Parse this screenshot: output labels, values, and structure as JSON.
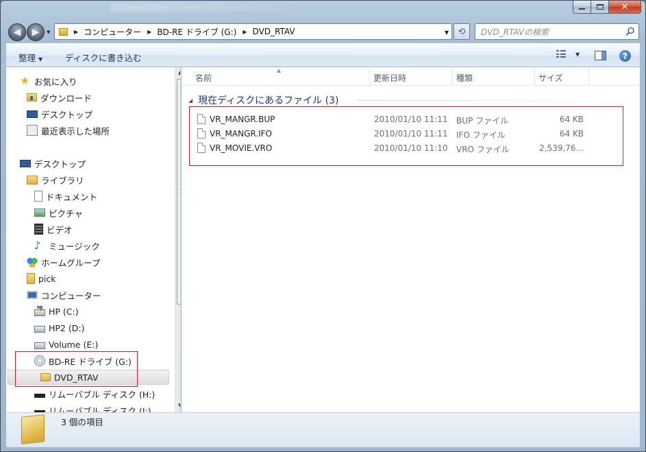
{
  "window": {
    "controls": {
      "minimize": "—",
      "maximize": "□",
      "close": "✕"
    }
  },
  "address": {
    "crumbs": [
      "コンピューター",
      "BD-RE ドライブ (G:)",
      "DVD_RTAV"
    ],
    "search_placeholder": "DVD_RTAVの検索"
  },
  "toolbar": {
    "organize_label": "整理",
    "burn_label": "ディスクに書き込む"
  },
  "nav": {
    "favorites": {
      "label": "お気に入り",
      "items": [
        "ダウンロード",
        "デスクトップ",
        "最近表示した場所"
      ]
    },
    "desktop_label": "デスクトップ",
    "libraries": {
      "label": "ライブラリ",
      "items": [
        "ドキュメント",
        "ピクチャ",
        "ビデオ",
        "ミュージック"
      ]
    },
    "homegroup_label": "ホームグループ",
    "user_label": "pick",
    "computer": {
      "label": "コンピューター",
      "drives": [
        "HP (C:)",
        "HP2 (D:)",
        "Volume (E:)",
        "BD-RE ドライブ (G:)"
      ],
      "selected_folder": "DVD_RTAV",
      "more_drives": [
        "リムーバブル ディスク (H:)",
        "リムーバブル ディスク (I:)"
      ]
    }
  },
  "columns": {
    "name": "名前",
    "date": "更新日時",
    "type": "種類",
    "size": "サイズ"
  },
  "group": {
    "title": "現在ディスクにあるファイル (3)"
  },
  "files": [
    {
      "name": "VR_MANGR.BUP",
      "date": "2010/01/10 11:11",
      "type": "BUP ファイル",
      "size": "64 KB"
    },
    {
      "name": "VR_MANGR.IFO",
      "date": "2010/01/10 11:11",
      "type": "IFO ファイル",
      "size": "64 KB"
    },
    {
      "name": "VR_MOVIE.VRO",
      "date": "2010/01/10 11:10",
      "type": "VRO ファイル",
      "size": "2,539,76..."
    }
  ],
  "status": {
    "item_count": "3 個の項目"
  },
  "colors": {
    "highlight": "#e0152b",
    "group_title": "#1e3287"
  }
}
